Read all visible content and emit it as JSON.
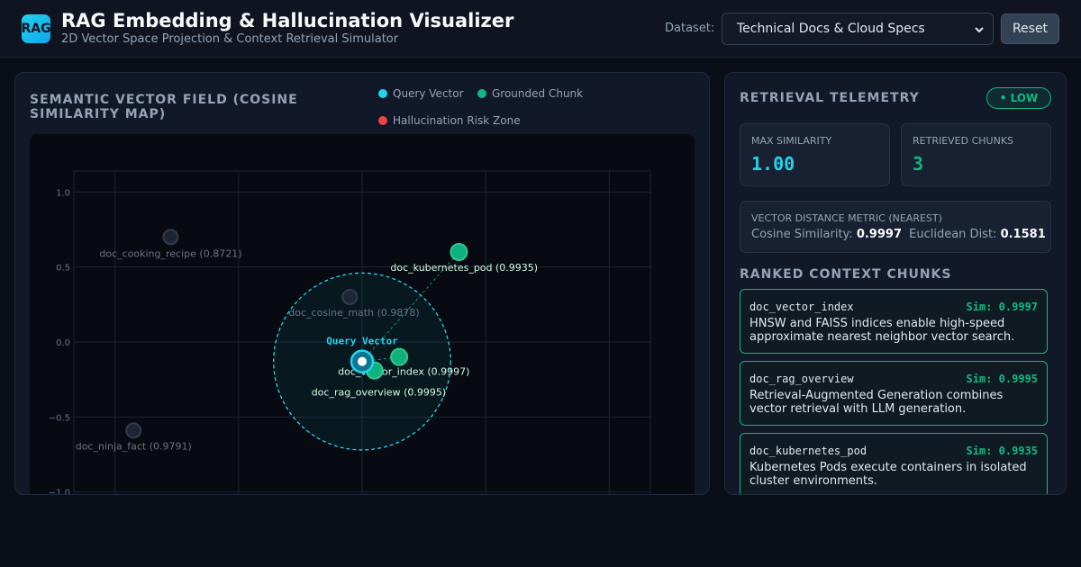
{
  "header": {
    "logo_text": "RAG",
    "title": "RAG Embedding & Hallucination Visualizer",
    "subtitle": "2D Vector Space Projection & Context Retrieval Simulator",
    "dataset_label": "Dataset:",
    "dataset_selected": "Technical Docs & Cloud Specs",
    "reset_label": "Reset"
  },
  "vector_panel": {
    "title": "SEMANTIC VECTOR FIELD (COSINE SIMILARITY MAP)",
    "legend": [
      {
        "label": "Query Vector",
        "color": "#22d3ee"
      },
      {
        "label": "Grounded Chunk",
        "color": "#10b981"
      },
      {
        "label": "Hallucination Risk Zone",
        "color": "#ef4444"
      }
    ]
  },
  "chart_data": {
    "type": "scatter",
    "yticks": [
      "1.0",
      "0.5",
      "0.0",
      "−0.5",
      "−1.0"
    ],
    "yvalues": [
      1.0,
      0.5,
      0.0,
      -0.5,
      -1.0
    ],
    "xlim": [
      -1.4,
      1.4
    ],
    "ylim": [
      -1.2,
      1.2
    ],
    "grid": true,
    "query": {
      "label": "Query Vector",
      "x": 0.0,
      "y": -0.13
    },
    "points": [
      {
        "label": "doc_cooking_recipe (0.8721)",
        "x": -0.93,
        "y": 0.7,
        "group": "background"
      },
      {
        "label": "doc_kubernetes_pod (0.9935)",
        "x": 0.47,
        "y": 0.6,
        "group": "grounded"
      },
      {
        "label": "doc_cosine_math (0.9878)",
        "x": -0.06,
        "y": 0.3,
        "group": "background"
      },
      {
        "label": "doc_vector_index (0.9997)",
        "x": 0.18,
        "y": -0.1,
        "group": "grounded"
      },
      {
        "label": "doc_rag_overview (0.9995)",
        "x": 0.06,
        "y": -0.19,
        "group": "grounded"
      },
      {
        "label": "doc_ninja_fact (0.9791)",
        "x": -1.11,
        "y": -0.59,
        "group": "background"
      }
    ],
    "retrieval_radius": 0.43
  },
  "telemetry": {
    "title": "RETRIEVAL TELEMETRY",
    "risk_badge": "• LOW",
    "max_similarity_label": "MAX SIMILARITY",
    "max_similarity_value": "1.00",
    "retrieved_chunks_label": "RETRIEVED CHUNKS",
    "retrieved_chunks_value": "3",
    "distance_label": "VECTOR DISTANCE METRIC (NEAREST)",
    "cosine_label": "Cosine Similarity:",
    "cosine_value": "0.9997",
    "euclid_label": "Euclidean Dist:",
    "euclid_value": "0.1581"
  },
  "chunks": {
    "title": "RANKED CONTEXT CHUNKS",
    "items": [
      {
        "id": "doc_vector_index",
        "sim": "Sim: 0.9997",
        "text": "HNSW and FAISS indices enable high-speed approximate nearest neighbor vector search."
      },
      {
        "id": "doc_rag_overview",
        "sim": "Sim: 0.9995",
        "text": "Retrieval-Augmented Generation combines vector retrieval with LLM generation."
      },
      {
        "id": "doc_kubernetes_pod",
        "sim": "Sim: 0.9935",
        "text": "Kubernetes Pods execute containers in isolated cluster environments."
      }
    ]
  }
}
